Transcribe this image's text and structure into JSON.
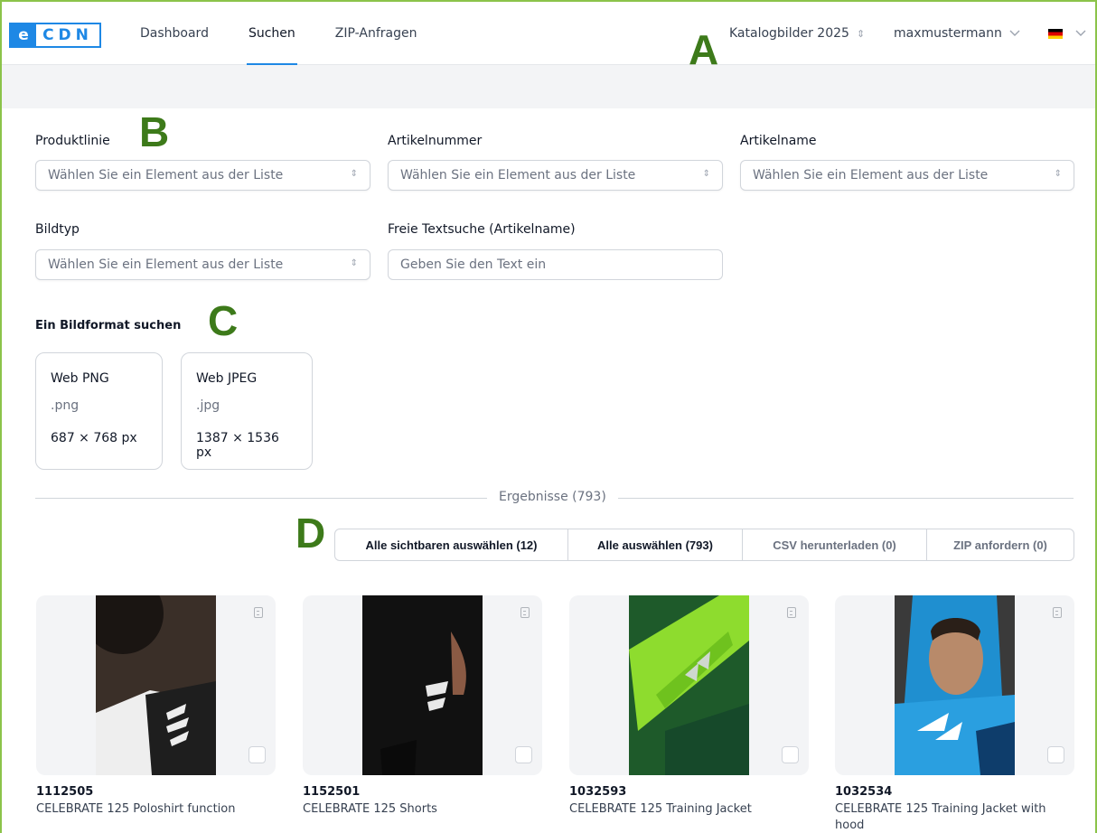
{
  "header": {
    "logo_left": "e",
    "logo_right": "CDN",
    "nav": [
      {
        "label": "Dashboard"
      },
      {
        "label": "Suchen",
        "active": true
      },
      {
        "label": "ZIP-Anfragen"
      }
    ],
    "catalog": "Katalogbilder 2025",
    "user": "maxmustermann",
    "language_icon": "flag-germany-icon"
  },
  "markers": {
    "a": "A",
    "b": "B",
    "c": "C",
    "d": "D"
  },
  "filters": {
    "produktlinie": {
      "label": "Produktlinie",
      "value": "Wählen Sie ein Element aus der Liste"
    },
    "artikelnummer": {
      "label": "Artikelnummer",
      "value": "Wählen Sie ein Element aus der Liste"
    },
    "artikelname": {
      "label": "Artikelname",
      "value": "Wählen Sie ein Element aus der Liste"
    },
    "bildtyp": {
      "label": "Bildtyp",
      "value": "Wählen Sie ein Element aus der Liste"
    },
    "freitext": {
      "label": "Freie Textsuche (Artikelname)",
      "placeholder": "Geben Sie den Text ein"
    }
  },
  "formats": {
    "title": "Ein Bildformat suchen",
    "items": [
      {
        "name": "Web PNG",
        "ext": ".png",
        "size": "687 × 768 px"
      },
      {
        "name": "Web JPEG",
        "ext": ".jpg",
        "size": "1387 × 1536 px"
      }
    ]
  },
  "results": {
    "label": "Ergebnisse (793)",
    "actions": [
      {
        "label": "Alle sichtbaren auswählen (12)"
      },
      {
        "label": "Alle auswählen (793)"
      },
      {
        "label": "CSV herunterladen (0)"
      },
      {
        "label": "ZIP anfordern (0)"
      }
    ],
    "products": [
      {
        "number": "1112505",
        "name": "CELEBRATE 125 Poloshirt function"
      },
      {
        "number": "1152501",
        "name": "CELEBRATE 125 Shorts"
      },
      {
        "number": "1032593",
        "name": "CELEBRATE 125 Training Jacket"
      },
      {
        "number": "1032534",
        "name": "CELEBRATE 125 Training Jacket with hood"
      }
    ]
  },
  "colors": {
    "accent": "#1e88e5",
    "marker": "#3d7a1a",
    "frame": "#8bc34a"
  }
}
